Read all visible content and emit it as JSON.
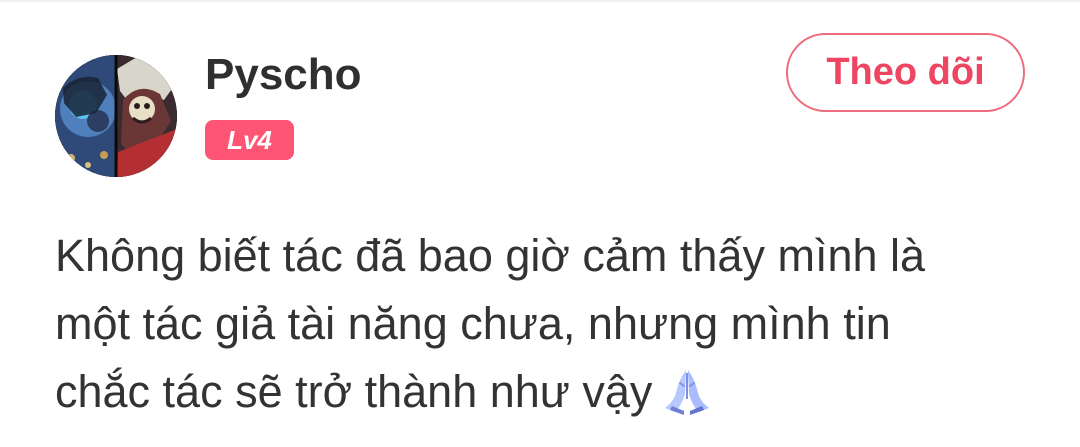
{
  "user": {
    "name": "Pyscho",
    "level": "Lv4",
    "avatar_icon": "comic-avatar"
  },
  "actions": {
    "follow_label": "Theo dõi"
  },
  "comment": {
    "lines": [
      "Không biết tác đã bao giờ cảm thấy mình là",
      "một tác giả tài năng chưa, nhưng mình tin",
      "chắc tác sẽ trở thành như vậy"
    ],
    "emoji": "praying-hands-icon"
  },
  "colors": {
    "accent": "#ff5574",
    "button_text": "#ee4563",
    "button_border": "#ee6a7d",
    "text": "#333333"
  }
}
